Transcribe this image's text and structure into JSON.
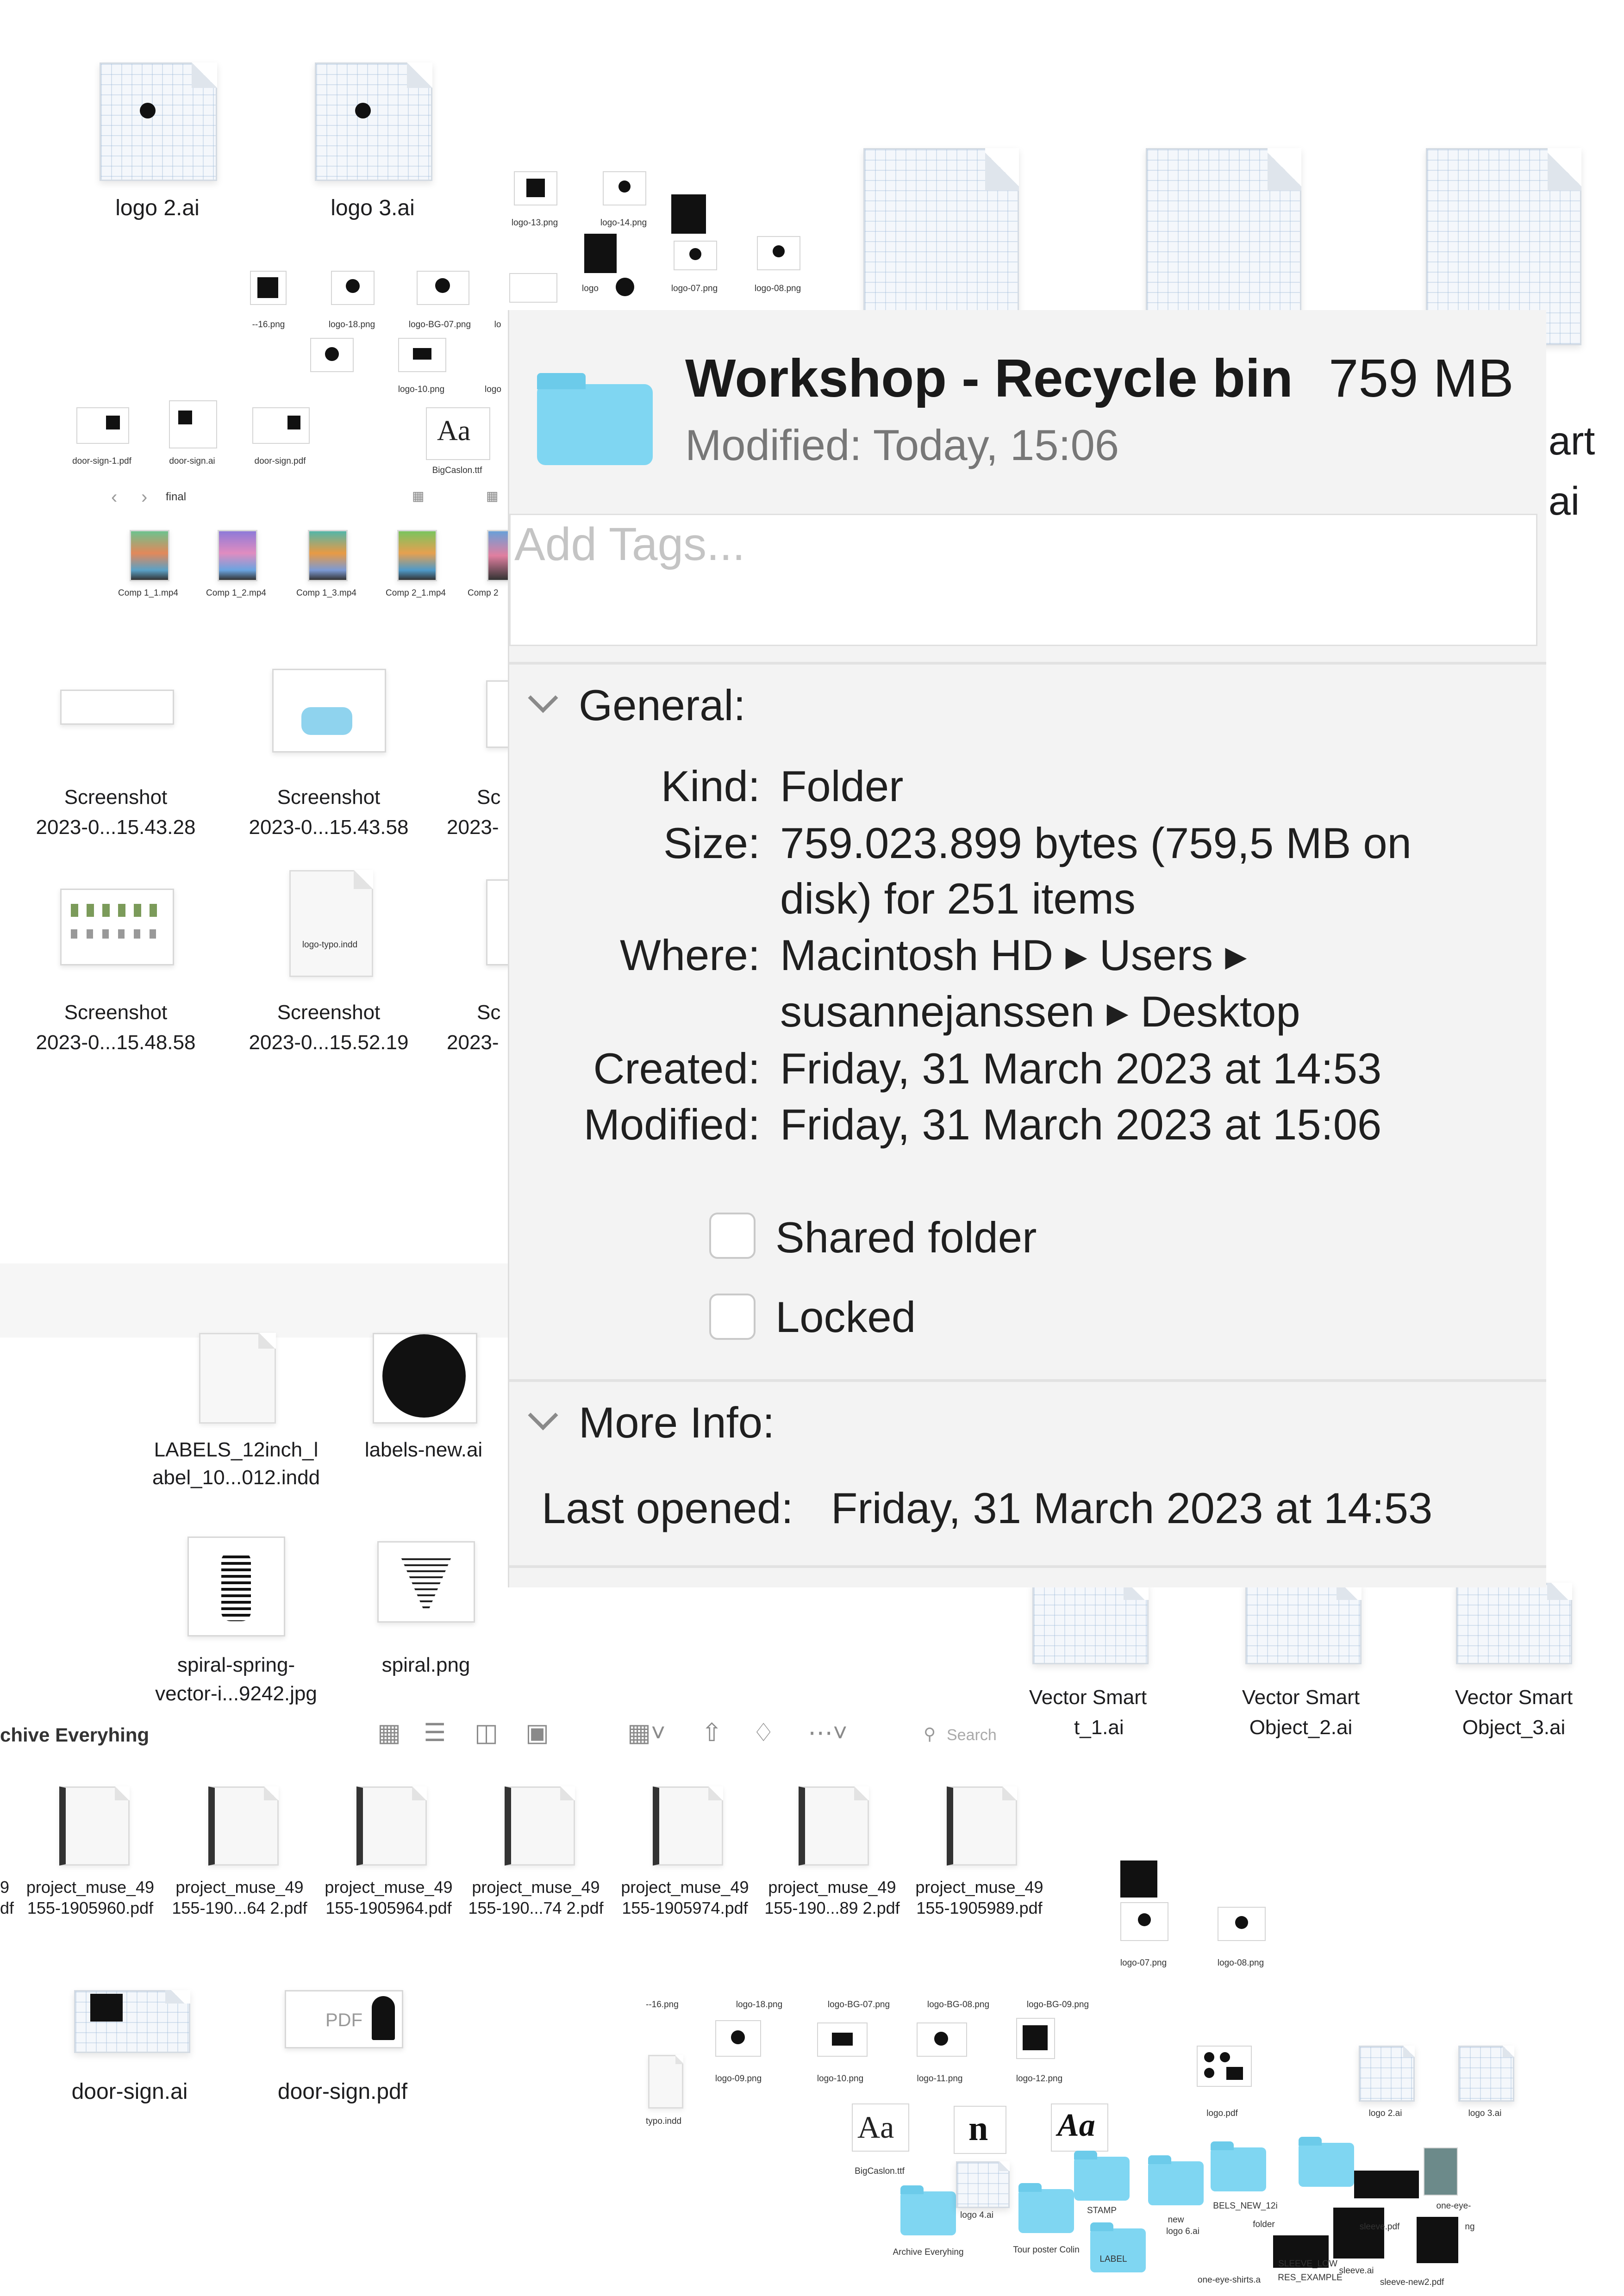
{
  "info_panel": {
    "title": "Workshop - Recycle bin",
    "size_badge": "759 MB",
    "modified_header": "Modified:  Today, 15:06",
    "tags_placeholder": "Add Tags...",
    "general": {
      "heading": "General:",
      "rows": [
        {
          "label": "Kind:",
          "value": "Folder"
        },
        {
          "label": "Size:",
          "value": "759.023.899 bytes (759,5 MB on",
          "value2": "disk) for 251 items"
        },
        {
          "label": "Where:",
          "value": "Macintosh HD ▸ Users ▸",
          "value2": "susannejanssen ▸ Desktop"
        },
        {
          "label": "Created:",
          "value": "Friday, 31 March 2023 at 14:53"
        },
        {
          "label": "Modified:",
          "value": "Friday, 31 March 2023 at 15:06"
        }
      ],
      "shared_folder_label": "Shared folder",
      "locked_label": "Locked",
      "shared_checked": false,
      "locked_checked": false
    },
    "more_info": {
      "heading": "More Info:",
      "last_opened_label": "Last opened:",
      "last_opened_value": "Friday, 31 March 2023 at 14:53"
    },
    "folder_color": "#7fd6f2"
  },
  "desktop": {
    "logo2": "logo 2.ai",
    "logo3": "logo 3.ai",
    "right_frag1": "art",
    "right_frag2": "ai",
    "small_pngs_top": [
      "logo-13.png",
      "logo-14.png",
      "logo-07.png",
      "logo-08.png",
      "logo"
    ],
    "small_pngs_row2": [
      "‑-16.png",
      "logo-18.png",
      "logo-BG-07.png",
      "lo"
    ],
    "small_pngs_row3": [
      "logo-10.png",
      "logo"
    ],
    "door_small": [
      "door-sign-1.pdf",
      "door-sign.ai",
      "door-sign.pdf"
    ],
    "bigcaslon_small": "BigCaslon.ttf",
    "aa_glyph": "Aa",
    "final_folder": "final",
    "comps": [
      "Comp 1_1.mp4",
      "Comp 1_2.mp4",
      "Comp 1_3.mp4",
      "Comp 2_1.mp4",
      "Comp 2"
    ],
    "screenshots": [
      {
        "l1": "Screenshot",
        "l2": "2023-0...15.43.28"
      },
      {
        "l1": "Screenshot",
        "l2": "2023-0...15.43.58"
      },
      {
        "l1": "Sc",
        "l2": "2023-"
      },
      {
        "l1": "Screenshot",
        "l2": "2023-0...15.48.58"
      },
      {
        "l1": "Screenshot",
        "l2": "2023-0...15.52.19"
      },
      {
        "l1": "Sc",
        "l2": "2023-"
      }
    ],
    "logo_typo": "logo-typo.indd",
    "labels_indd_l1": "LABELS_12inch_l",
    "labels_indd_l2": "abel_10...012.indd",
    "labels_new": "labels-new.ai",
    "spiral_spring_l1": "spiral-spring-",
    "spiral_spring_l2": "vector-i...9242.jpg",
    "spiral_png": "spiral.png",
    "vector_smart": [
      {
        "l1": "Vector Smart",
        "l2": "t_1.ai"
      },
      {
        "l1": "Vector Smart",
        "l2": "Object_2.ai"
      },
      {
        "l1": "Vector Smart",
        "l2": "Object_3.ai"
      }
    ],
    "archive_window_title": "chive Everyhing",
    "search_placeholder": "Search",
    "project_files": [
      {
        "l1": "9",
        "l2": "df"
      },
      {
        "l1": "project_muse_49",
        "l2": "155-1905960.pdf"
      },
      {
        "l1": "project_muse_49",
        "l2": "155-190...64 2.pdf"
      },
      {
        "l1": "project_muse_49",
        "l2": "155-1905964.pdf"
      },
      {
        "l1": "project_muse_49",
        "l2": "155-190...74 2.pdf"
      },
      {
        "l1": "project_muse_49",
        "l2": "155-1905974.pdf"
      },
      {
        "l1": "project_muse_49",
        "l2": "155-190...89 2.pdf"
      },
      {
        "l1": "project_muse_49",
        "l2": "155-1905989.pdf"
      }
    ],
    "door_ai": "door-sign.ai",
    "door_pdf": "door-sign.pdf",
    "pdf_badge": "PDF",
    "br_logo07": "logo-07.png",
    "br_logo08": "logo-08.png",
    "br_row1": [
      "‑-16.png",
      "logo-18.png",
      "logo-BG-07.png",
      "logo-BG-08.png",
      "logo-BG-09.png"
    ],
    "br_row2": [
      "logo-09.png",
      "logo-10.png",
      "logo-11.png",
      "logo-12.png"
    ],
    "br_typo": "typo.indd",
    "br_logo_pdf": "logo.pdf",
    "br_logo2": "logo 2.ai",
    "br_logo3": "logo 3.ai",
    "br_bigcaslon": "BigCaslon.ttf",
    "br_archive": "Archive Everyhing",
    "br_tour": "Tour poster Colin",
    "br_stamp": "STAMP",
    "br_label": "LABEL",
    "br_logo4": "logo 4.ai",
    "br_logo6": "logo 6.ai",
    "br_new": "new",
    "br_sleeve_pdf": "sleeve.pdf",
    "br_sleeve_ai": "sleeve.ai",
    "br_sleeve_new2": "sleeve-new2.pdf",
    "br_one_eye": "one-eye-shirts.a",
    "br_labels_new": "BELS_NEW_12i",
    "br_folder": "folder",
    "br_sleeve_low": "SLEEVE_LOW",
    "br_res_example": "RES_EXAMPLE",
    "br_one_eye2": "one-eye-",
    "br_ng": "ng"
  }
}
